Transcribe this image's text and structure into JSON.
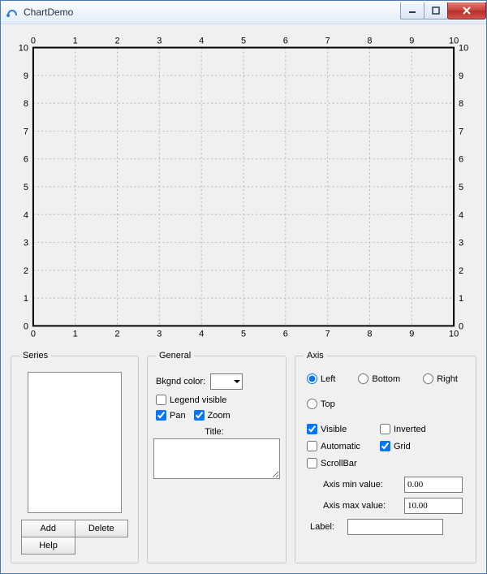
{
  "window": {
    "title": "ChartDemo"
  },
  "chart_data": {
    "type": "scatter",
    "series": [],
    "categories": [],
    "title": "",
    "xlabel": "",
    "ylabel": "",
    "xlim": [
      0,
      10
    ],
    "ylim": [
      0,
      10
    ],
    "xticks": [
      0,
      1,
      2,
      3,
      4,
      5,
      6,
      7,
      8,
      9,
      10
    ],
    "yticks": [
      0,
      1,
      2,
      3,
      4,
      5,
      6,
      7,
      8,
      9,
      10
    ],
    "grid": true
  },
  "series_panel": {
    "legend": "Series",
    "items": [],
    "add": "Add",
    "delete": "Delete",
    "help": "Help"
  },
  "general": {
    "legend": "General",
    "bkgnd_label": "Bkgnd color:",
    "bkgnd_color": "",
    "legend_visible_label": "Legend visible",
    "legend_visible": false,
    "pan_label": "Pan",
    "pan": true,
    "zoom_label": "Zoom",
    "zoom": true,
    "title_label": "Title:",
    "title_value": ""
  },
  "axis": {
    "legend": "Axis",
    "options": {
      "left": "Left",
      "bottom": "Bottom",
      "right": "Right",
      "top": "Top"
    },
    "selected": "left",
    "visible_label": "Visible",
    "visible": true,
    "inverted_label": "Inverted",
    "inverted": false,
    "automatic_label": "Automatic",
    "automatic": false,
    "grid_label": "Grid",
    "grid": true,
    "scrollbar_label": "ScrollBar",
    "scrollbar": false,
    "min_label": "Axis min value:",
    "min_value": "0.00",
    "max_label": "Axis max value:",
    "max_value": "10.00",
    "label_label": "Label:",
    "label_value": ""
  }
}
